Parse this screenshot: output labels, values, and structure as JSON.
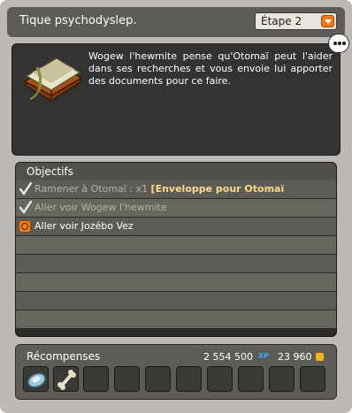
{
  "header": {
    "title": "Tique psychodyslep.",
    "step_value": "Étape 2"
  },
  "description": {
    "text": "Wogew l'hewmite pense qu'Otomaï peut l'aider dans ses recherches et vous envoie lui apporter des documents pour ce faire."
  },
  "objectives": {
    "header": "Objectifs",
    "items": [
      {
        "prefix": "Ramener à Otomaï : x1 ",
        "highlight": "[Enveloppe pour Otomaï",
        "status": "done"
      },
      {
        "prefix": "Aller voir Wogew l'hewmite",
        "highlight": "",
        "status": "done"
      },
      {
        "prefix": "Aller voir Jozébo Vez",
        "highlight": "",
        "status": "active"
      }
    ]
  },
  "rewards": {
    "label": "Récompenses",
    "xp_value": "2 554 500",
    "xp_unit": "XP",
    "kamas_value": "23 960",
    "items": [
      {
        "icon": "gem-item-icon"
      },
      {
        "icon": "bone-item-icon"
      }
    ]
  },
  "colors": {
    "accent_orange": "#f07a1a",
    "highlight_text": "#ffd98a",
    "xp_blue": "#4aa3ff"
  }
}
